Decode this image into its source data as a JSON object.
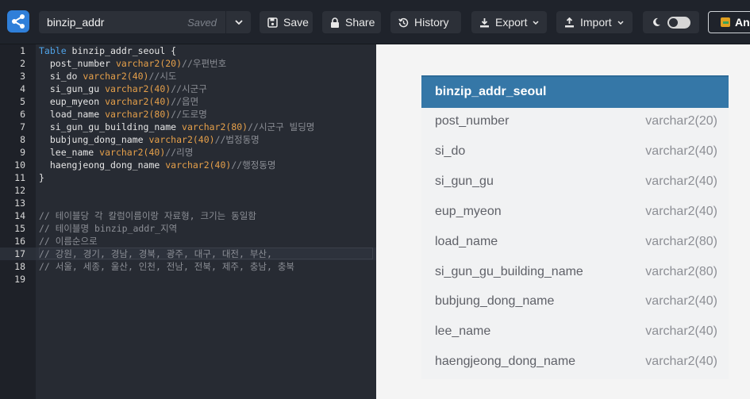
{
  "header": {
    "doc_name": "binzip_addr",
    "save_state": "Saved",
    "buttons": {
      "save": "Save",
      "share": "Share",
      "history": "History",
      "export": "Export",
      "import": "Import",
      "analyze": "Ana"
    }
  },
  "editor": {
    "active_line": 17,
    "lines": [
      {
        "n": "1",
        "kw": "Table",
        "rest": " binzip_addr_seoul {"
      },
      {
        "n": "2",
        "col": "  post_number ",
        "type": "varchar2(20)",
        "cmt": "//우편번호"
      },
      {
        "n": "3",
        "col": "  si_do ",
        "type": "varchar2(40)",
        "cmt": "//시도"
      },
      {
        "n": "4",
        "col": "  si_gun_gu ",
        "type": "varchar2(40)",
        "cmt": "//시군구"
      },
      {
        "n": "5",
        "col": "  eup_myeon ",
        "type": "varchar2(40)",
        "cmt": "//읍면"
      },
      {
        "n": "6",
        "col": "  load_name ",
        "type": "varchar2(80)",
        "cmt": "//도로명"
      },
      {
        "n": "7",
        "col": "  si_gun_gu_building_name ",
        "type": "varchar2(80)",
        "cmt": "//시군구 빌딩명"
      },
      {
        "n": "8",
        "col": "  bubjung_dong_name ",
        "type": "varchar2(40)",
        "cmt": "//법정동명"
      },
      {
        "n": "9",
        "col": "  lee_name ",
        "type": "varchar2(40)",
        "cmt": "//리명"
      },
      {
        "n": "10",
        "col": "  haengjeong_dong_name ",
        "type": "varchar2(40)",
        "cmt": "//행정동명"
      },
      {
        "n": "11",
        "plain": "}"
      },
      {
        "n": "12",
        "plain": ""
      },
      {
        "n": "13",
        "plain": ""
      },
      {
        "n": "14",
        "comment": "// 테이블당 각 칼럼이름이랑 자료형, 크기는 동일함"
      },
      {
        "n": "15",
        "comment": "// 테이블명 binzip_addr_지역"
      },
      {
        "n": "16",
        "comment": "// 이름순으로"
      },
      {
        "n": "17",
        "comment": "// 강원, 경기, 경남, 경북, 광주, 대구, 대전, 부산,"
      },
      {
        "n": "18",
        "comment": "// 서울, 세종, 울산, 인천, 전남, 전북, 제주, 충남, 충북"
      },
      {
        "n": "19",
        "plain": ""
      }
    ]
  },
  "diagram": {
    "table_name": "binzip_addr_seoul",
    "columns": [
      {
        "name": "post_number",
        "type": "varchar2(20)"
      },
      {
        "name": "si_do",
        "type": "varchar2(40)"
      },
      {
        "name": "si_gun_gu",
        "type": "varchar2(40)"
      },
      {
        "name": "eup_myeon",
        "type": "varchar2(40)"
      },
      {
        "name": "load_name",
        "type": "varchar2(80)"
      },
      {
        "name": "si_gun_gu_building_name",
        "type": "varchar2(80)"
      },
      {
        "name": "bubjung_dong_name",
        "type": "varchar2(40)"
      },
      {
        "name": "lee_name",
        "type": "varchar2(40)"
      },
      {
        "name": "haengjeong_dong_name",
        "type": "varchar2(40)"
      }
    ]
  },
  "colors": {
    "accent": "#2f7fd9",
    "table_header": "#3577a7",
    "keyword": "#4fa3e8",
    "type": "#e6a04a",
    "comment": "#8c8f96"
  },
  "icons": {
    "logo": "share-nodes-icon",
    "save": "floppy-disk-icon",
    "share": "lock-icon",
    "history": "history-icon",
    "export": "download-icon",
    "import": "upload-icon",
    "theme": "moon-icon",
    "collapse": "chevron-left-icon"
  }
}
